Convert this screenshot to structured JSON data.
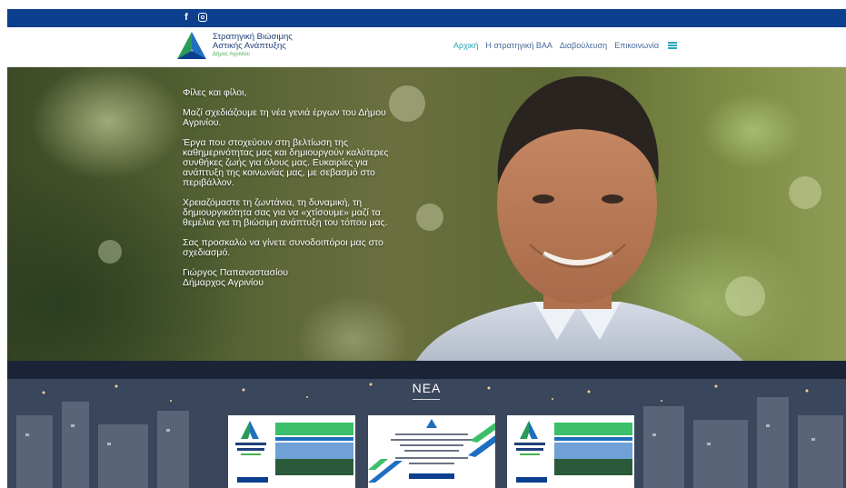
{
  "topbar": {
    "color": "#0d3f8f",
    "social": [
      {
        "icon": "facebook-icon",
        "glyph": "f"
      },
      {
        "icon": "instagram-icon",
        "glyph": ""
      }
    ]
  },
  "header": {
    "logo": {
      "line1": "Στρατηγική Βιώσιμης",
      "line2": "Αστικής Ανάπτυξης",
      "line3": "Δήμος Αγρινίου"
    },
    "nav": [
      {
        "label": "Αρχική",
        "active": true
      },
      {
        "label": "Η στρατηγική ΒΑΑ",
        "active": false
      },
      {
        "label": "Διαβούλευση",
        "active": false
      },
      {
        "label": "Επικοινωνία",
        "active": false
      }
    ],
    "menu_icon": "hamburger-icon",
    "accent": "#2aa5b5"
  },
  "hero": {
    "greeting": "Φίλες και φίλοι,",
    "p1": "Μαζί σχεδιάζουμε τη νέα γενιά έργων του Δήμου Αγρινίου.",
    "p2": "Έργα που στοχεύουν στη βελτίωση της καθημερινότητας μας και δημιουργούν καλύτερες συνθήκες ζωής για όλους μας. Ευκαιρίες για ανάπτυξη της κοινωνίας μας, με σεβασμό στο περιβάλλον.",
    "p3": "Χρειαζόμαστε τη ζωντάνια, τη δυναμική, τη δημιουργικότητα σας για να «χτίσουμε» μαζί τα θεμέλια για τη βιώσιμη ανάπτυξη του τόπου μας.",
    "p4": "Σας προσκαλώ να γίνετε συνοδοιπόροι μας στο σχεδιασμό.",
    "signature_name": "Γιώργος Παπαναστασίου",
    "signature_title": "Δήμαρχος Αγρινίου"
  },
  "news": {
    "title": "ΝΕΑ",
    "cards": [
      {
        "banner": "Η Διαβούλευση συνεχίζεται"
      },
      {
        "banner": ""
      },
      {
        "banner": "Η Διαβούλευση συνεχίζεται"
      }
    ]
  }
}
